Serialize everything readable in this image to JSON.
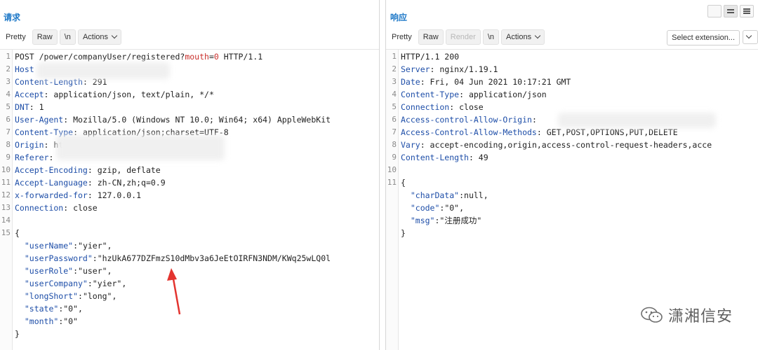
{
  "request": {
    "title": "请求",
    "tabs": [
      "Pretty",
      "Raw",
      "\\n",
      "Actions"
    ],
    "lines": [
      {
        "n": "1",
        "parts": [
          {
            "t": "POST /power/companyUser/registered?",
            "c": ""
          },
          {
            "t": "mouth",
            "c": "red"
          },
          {
            "t": "=",
            "c": ""
          },
          {
            "t": "0",
            "c": "red"
          },
          {
            "t": " HTTP/1.1",
            "c": ""
          }
        ]
      },
      {
        "n": "2",
        "parts": [
          {
            "t": "Host",
            "c": "k"
          }
        ]
      },
      {
        "n": "3",
        "parts": [
          {
            "t": "Content-Length",
            "c": "k"
          },
          {
            "t": ": 291",
            "c": ""
          }
        ]
      },
      {
        "n": "4",
        "parts": [
          {
            "t": "Accept",
            "c": "k"
          },
          {
            "t": ": application/json, text/plain, */*",
            "c": ""
          }
        ]
      },
      {
        "n": "5",
        "parts": [
          {
            "t": "DNT",
            "c": "k"
          },
          {
            "t": ": 1",
            "c": ""
          }
        ]
      },
      {
        "n": "6",
        "parts": [
          {
            "t": "User-Agent",
            "c": "k"
          },
          {
            "t": ": Mozilla/5.0 (Windows NT 10.0; Win64; x64) AppleWebKit",
            "c": ""
          }
        ]
      },
      {
        "n": "7",
        "parts": [
          {
            "t": "Content-Type",
            "c": "k"
          },
          {
            "t": ": application/json;charset=UTF-8",
            "c": ""
          }
        ]
      },
      {
        "n": "8",
        "parts": [
          {
            "t": "Origin",
            "c": "k"
          },
          {
            "t": ": ht",
            "c": ""
          }
        ]
      },
      {
        "n": "9",
        "parts": [
          {
            "t": "Referer",
            "c": "k"
          },
          {
            "t": ": ",
            "c": ""
          }
        ]
      },
      {
        "n": "10",
        "parts": [
          {
            "t": "Accept-Encoding",
            "c": "k"
          },
          {
            "t": ": gzip, deflate",
            "c": ""
          }
        ]
      },
      {
        "n": "11",
        "parts": [
          {
            "t": "Accept-Language",
            "c": "k"
          },
          {
            "t": ": zh-CN,zh;q=0.9",
            "c": ""
          }
        ]
      },
      {
        "n": "12",
        "parts": [
          {
            "t": "x-forwarded-for",
            "c": "k"
          },
          {
            "t": ": 127.0.0.1",
            "c": ""
          }
        ]
      },
      {
        "n": "13",
        "parts": [
          {
            "t": "Connection",
            "c": "k"
          },
          {
            "t": ": close",
            "c": ""
          }
        ]
      },
      {
        "n": "14",
        "parts": []
      },
      {
        "n": "15",
        "parts": [
          {
            "t": "{",
            "c": ""
          }
        ]
      },
      {
        "n": "",
        "parts": [
          {
            "t": "  \"userName\"",
            "c": "jk"
          },
          {
            "t": ":\"yier\",",
            "c": ""
          }
        ]
      },
      {
        "n": "",
        "parts": [
          {
            "t": "  \"userPassword\"",
            "c": "jk"
          },
          {
            "t": ":\"hzUkA677DZFmzS10dMbv3a6JeEtOIRFN3NDM/KWq25wLQ0l",
            "c": ""
          }
        ]
      },
      {
        "n": "",
        "parts": [
          {
            "t": "  \"userRole\"",
            "c": "jk"
          },
          {
            "t": ":\"user\",",
            "c": ""
          }
        ]
      },
      {
        "n": "",
        "parts": [
          {
            "t": "  \"userCompany\"",
            "c": "jk"
          },
          {
            "t": ":\"yier\",",
            "c": ""
          }
        ]
      },
      {
        "n": "",
        "parts": [
          {
            "t": "  \"longShort\"",
            "c": "jk"
          },
          {
            "t": ":\"long\",",
            "c": ""
          }
        ]
      },
      {
        "n": "",
        "parts": [
          {
            "t": "  \"state\"",
            "c": "jk"
          },
          {
            "t": ":\"0\",",
            "c": ""
          }
        ]
      },
      {
        "n": "",
        "parts": [
          {
            "t": "  \"month\"",
            "c": "jk"
          },
          {
            "t": ":\"0\"",
            "c": ""
          }
        ]
      },
      {
        "n": "",
        "parts": [
          {
            "t": "}",
            "c": ""
          }
        ]
      }
    ]
  },
  "response": {
    "title": "响应",
    "tabs": [
      "Pretty",
      "Raw",
      "Render",
      "\\n",
      "Actions"
    ],
    "select_extension": "Select extension...",
    "lines": [
      {
        "n": "1",
        "parts": [
          {
            "t": "HTTP/1.1 200",
            "c": ""
          }
        ]
      },
      {
        "n": "2",
        "parts": [
          {
            "t": "Server",
            "c": "k"
          },
          {
            "t": ": nginx/1.19.1",
            "c": ""
          }
        ]
      },
      {
        "n": "3",
        "parts": [
          {
            "t": "Date",
            "c": "k"
          },
          {
            "t": ": Fri, 04 Jun 2021 10:17:21 GMT",
            "c": ""
          }
        ]
      },
      {
        "n": "4",
        "parts": [
          {
            "t": "Content-Type",
            "c": "k"
          },
          {
            "t": ": application/json",
            "c": ""
          }
        ]
      },
      {
        "n": "5",
        "parts": [
          {
            "t": "Connection",
            "c": "k"
          },
          {
            "t": ": close",
            "c": ""
          }
        ]
      },
      {
        "n": "6",
        "parts": [
          {
            "t": "Access-control-Allow-Origin",
            "c": "k"
          },
          {
            "t": ":",
            "c": ""
          }
        ]
      },
      {
        "n": "7",
        "parts": [
          {
            "t": "Access-Control-Allow-Methods",
            "c": "k"
          },
          {
            "t": ": GET,POST,OPTIONS,PUT,DELETE",
            "c": ""
          }
        ]
      },
      {
        "n": "8",
        "parts": [
          {
            "t": "Vary",
            "c": "k"
          },
          {
            "t": ": accept-encoding,origin,access-control-request-headers,acce",
            "c": ""
          }
        ]
      },
      {
        "n": "9",
        "parts": [
          {
            "t": "Content-Length",
            "c": "k"
          },
          {
            "t": ": 49",
            "c": ""
          }
        ]
      },
      {
        "n": "10",
        "parts": []
      },
      {
        "n": "11",
        "parts": [
          {
            "t": "{",
            "c": ""
          }
        ]
      },
      {
        "n": "",
        "parts": [
          {
            "t": "  \"charData\"",
            "c": "jk"
          },
          {
            "t": ":null,",
            "c": ""
          }
        ]
      },
      {
        "n": "",
        "parts": [
          {
            "t": "  \"code\"",
            "c": "jk"
          },
          {
            "t": ":\"0\",",
            "c": ""
          }
        ]
      },
      {
        "n": "",
        "parts": [
          {
            "t": "  \"msg\"",
            "c": "jk"
          },
          {
            "t": ":\"注册成功\"",
            "c": ""
          }
        ]
      },
      {
        "n": "",
        "parts": [
          {
            "t": "}",
            "c": ""
          }
        ]
      }
    ]
  },
  "watermark": "潇湘信安",
  "colors": {
    "title": "#1f79c8",
    "key": "#1e4ea8",
    "param": "#c9302c",
    "arrow": "#e3342f"
  }
}
